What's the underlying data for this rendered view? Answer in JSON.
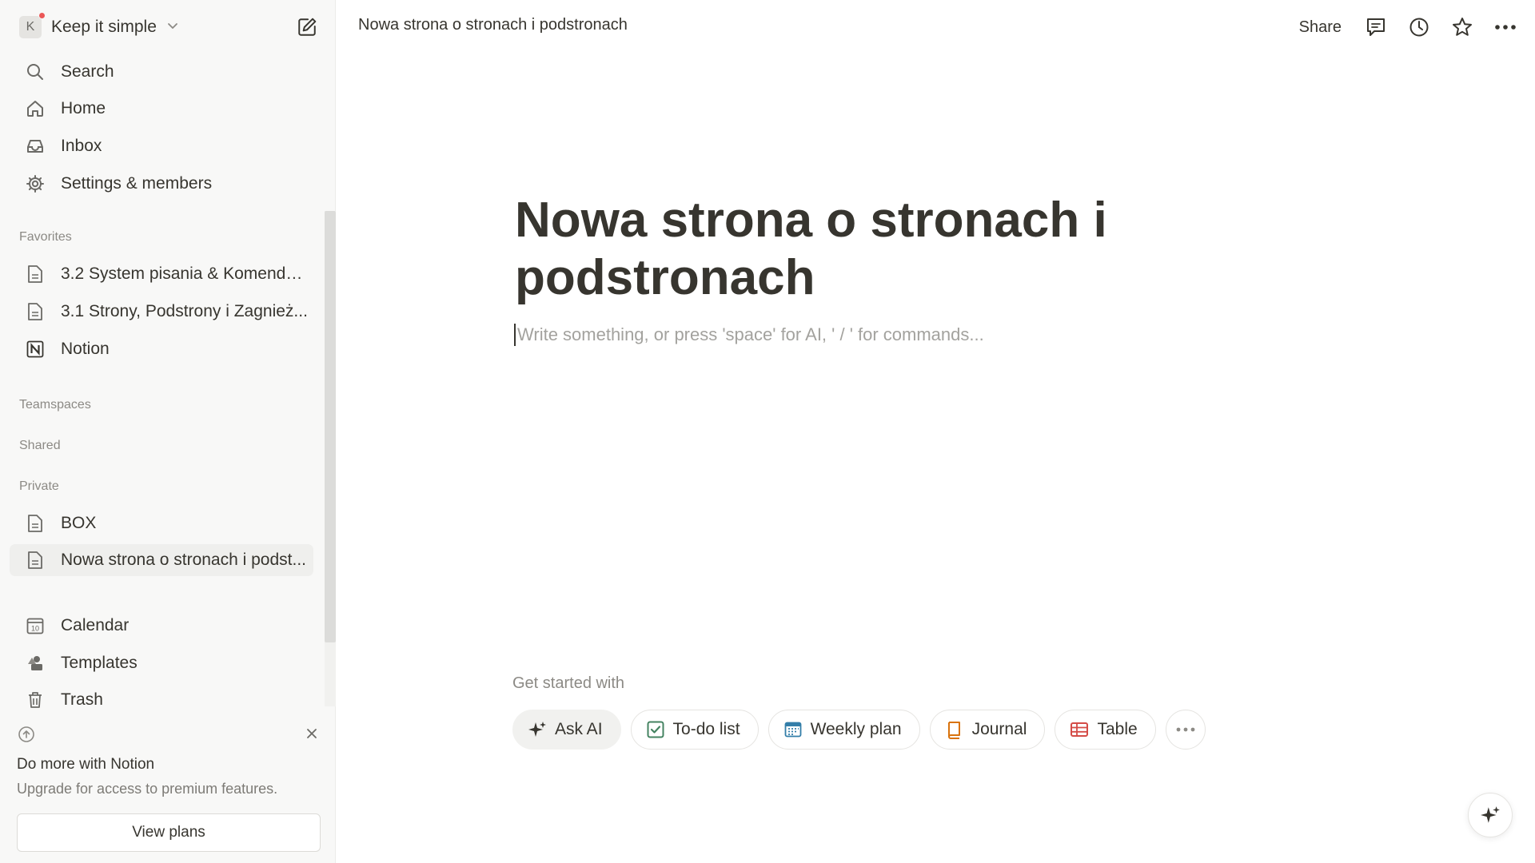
{
  "workspace": {
    "initial": "K",
    "name": "Keep it simple"
  },
  "sidebar": {
    "nav": [
      {
        "label": "Search",
        "icon": "search-icon"
      },
      {
        "label": "Home",
        "icon": "home-icon"
      },
      {
        "label": "Inbox",
        "icon": "inbox-icon"
      },
      {
        "label": "Settings & members",
        "icon": "gear-icon"
      }
    ],
    "favorites_heading": "Favorites",
    "favorites": [
      {
        "label": "3.2 System pisania & Komendy ...",
        "icon": "page-icon"
      },
      {
        "label": "3.1 Strony, Podstrony i Zagnież...",
        "icon": "page-icon"
      },
      {
        "label": "Notion",
        "icon": "notion-logo-icon"
      }
    ],
    "teamspaces_heading": "Teamspaces",
    "shared_heading": "Shared",
    "private_heading": "Private",
    "private": [
      {
        "label": "BOX",
        "icon": "page-icon"
      },
      {
        "label": "Nowa strona o stronach i podst...",
        "icon": "page-icon",
        "active": true
      }
    ],
    "tools": [
      {
        "label": "Calendar",
        "icon": "calendar-icon",
        "icon_text": "10"
      },
      {
        "label": "Templates",
        "icon": "templates-icon"
      },
      {
        "label": "Trash",
        "icon": "trash-icon"
      }
    ],
    "upgrade": {
      "title": "Do more with Notion",
      "subtitle": "Upgrade for access to premium features.",
      "button": "View plans"
    }
  },
  "topbar": {
    "breadcrumb": "Nowa strona o stronach i podstronach",
    "share": "Share",
    "icons": [
      "comment-icon",
      "history-icon",
      "star-icon",
      "more-icon"
    ]
  },
  "page": {
    "title": "Nowa strona o stronach i podstronach",
    "placeholder": "Write something, or press 'space' for AI, ' / ' for commands..."
  },
  "get_started": {
    "heading": "Get started with",
    "chips": [
      {
        "label": "Ask AI",
        "icon": "sparkle-icon"
      },
      {
        "label": "To-do list",
        "icon": "checkbox-icon"
      },
      {
        "label": "Weekly plan",
        "icon": "calendar-icon"
      },
      {
        "label": "Journal",
        "icon": "book-icon"
      },
      {
        "label": "Table",
        "icon": "table-icon"
      }
    ]
  },
  "colors": {
    "text": "#37352f",
    "muted": "#8c8a85",
    "sidebar_bg": "#f8f8f7",
    "notification_dot": "#eb5757",
    "todo_green": "#448361",
    "weekly_blue": "#337ea9",
    "journal_orange": "#d9730d",
    "table_red": "#d44c47"
  }
}
